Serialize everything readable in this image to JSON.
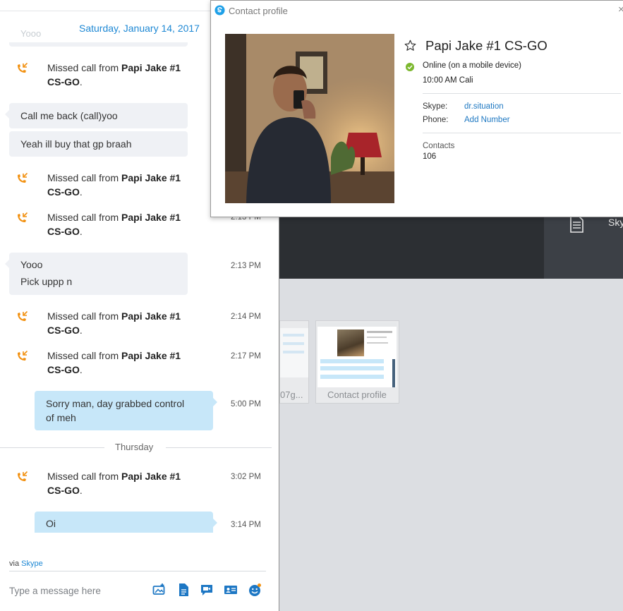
{
  "background": {
    "tile_label": "Sky",
    "thumb_left_label": "07g...",
    "thumb_right_label": "Contact profile"
  },
  "chat": {
    "top_ghost_text": "Yooo",
    "date_header": "Saturday, January 14, 2017",
    "missed_prefix": "Missed call from ",
    "missed_name_1": "Papi Jake #1",
    "missed_name_2": "CS-GO",
    "missed_suffix": ".",
    "messages": [
      {
        "text": "Call me back (call)yoo"
      },
      {
        "text": "Yeah ill buy that gp braah"
      },
      {
        "text_line1": "Yooo",
        "text_line2": "Pick uppp n",
        "time": "2:13 PM"
      },
      {
        "text_line1": "Sorry man, day grabbed control",
        "text_line2": "of meh",
        "time": "5:00 PM"
      },
      {
        "text": "Oi",
        "time": "3:14 PM"
      }
    ],
    "missed_times": [
      "2:13 PM",
      "2:14 PM",
      "2:17 PM",
      "3:02 PM"
    ],
    "day_separator": "Thursday",
    "via_prefix": "via ",
    "via_link": "Skype",
    "compose_placeholder": "Type a message here"
  },
  "profile": {
    "window_title": "Contact profile",
    "close_glyph": "×",
    "name": "Papi Jake #1 CS-GO",
    "status": "Online (on a mobile device)",
    "local_time": "10:00 AM Cali",
    "skype_label": "Skype:",
    "skype_value": "dr.situation",
    "phone_label": "Phone:",
    "phone_value": "Add Number",
    "contacts_label": "Contacts",
    "contacts_count": "106"
  },
  "colors": {
    "accent": "#1e88d4",
    "missed_call": "#f29111",
    "online": "#7cb82f",
    "bubble_in": "#eff1f5",
    "bubble_out": "#c7e7f9"
  },
  "icons": {
    "missed_call": "missed-call-icon",
    "star": "star-icon",
    "status": "online-status-icon",
    "compose": [
      "media-icon",
      "file-icon",
      "video-message-icon",
      "contact-card-icon",
      "emoji-icon"
    ]
  }
}
